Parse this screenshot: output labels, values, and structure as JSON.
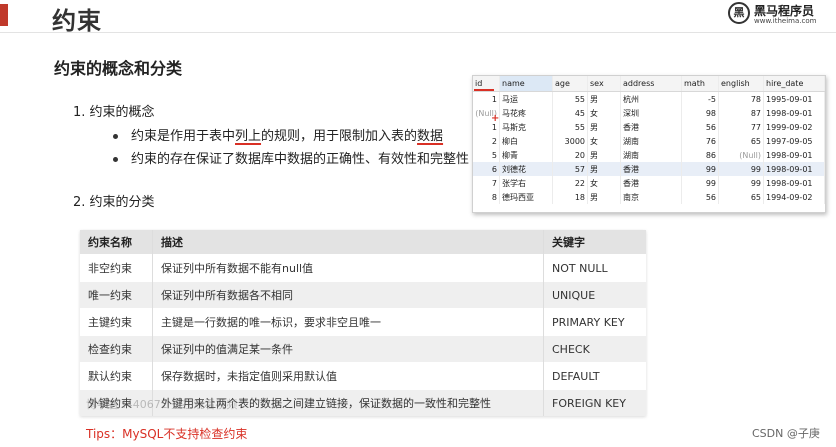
{
  "header": {
    "title": "约束",
    "logo_mark": "黑",
    "logo_name": "黑马程序员",
    "logo_url": "www.itheima.com"
  },
  "section_title": "约束的概念和分类",
  "item1": {
    "title": "1. 约束的概念",
    "bullet1": {
      "pre": "约束是作用于表中",
      "ul1": "列上",
      "mid": "的规则，用于限制加入表的",
      "ul2": "数据",
      "post": ""
    },
    "bullet2": "约束的存在保证了数据库中数据的正确性、有效性和完整性"
  },
  "item2": {
    "title": "2. 约束的分类"
  },
  "emp_table": {
    "headers": [
      "id",
      "name",
      "age",
      "sex",
      "address",
      "math",
      "english",
      "hire_date"
    ],
    "rows": [
      [
        "1",
        "马运",
        "55",
        "男",
        "杭州",
        "-5",
        "78",
        "1995-09-01"
      ],
      [
        "(Null)",
        "马花疼",
        "45",
        "女",
        "深圳",
        "98",
        "87",
        "1998-09-01"
      ],
      [
        "1",
        "马斯克",
        "55",
        "男",
        "香港",
        "56",
        "77",
        "1999-09-02"
      ],
      [
        "2",
        "柳白",
        "3000",
        "女",
        "湖南",
        "76",
        "65",
        "1997-09-05"
      ],
      [
        "5",
        "柳青",
        "20",
        "男",
        "湖南",
        "86",
        "(Null)",
        "1998-09-01"
      ],
      [
        "6",
        "刘德花",
        "57",
        "男",
        "香港",
        "99",
        "99",
        "1998-09-01"
      ],
      [
        "7",
        "张学右",
        "22",
        "女",
        "香港",
        "99",
        "99",
        "1998-09-01"
      ],
      [
        "8",
        "德玛西亚",
        "18",
        "男",
        "南京",
        "56",
        "65",
        "1994-09-02"
      ]
    ]
  },
  "constraint_table": {
    "headers": [
      "约束名称",
      "描述",
      "关键字"
    ],
    "rows": [
      [
        "非空约束",
        "保证列中所有数据不能有null值",
        "NOT NULL"
      ],
      [
        "唯一约束",
        "保证列中所有数据各不相同",
        "UNIQUE"
      ],
      [
        "主键约束",
        "主键是一行数据的唯一标识，要求非空且唯一",
        "PRIMARY KEY"
      ],
      [
        "检查约束",
        "保证列中的值满足某一条件",
        "CHECK"
      ],
      [
        "默认约束",
        "保存数据时，未指定值则采用默认值",
        "DEFAULT"
      ],
      [
        "外键约束",
        "外键用来让两个表的数据之间建立链接，保证数据的一致性和完整性",
        "FOREIGN KEY"
      ]
    ]
  },
  "watermark": "博学谷 I440672 正在观看视频",
  "tips": "Tips：MySQL不支持检查约束",
  "footer": "CSDN @子庚"
}
